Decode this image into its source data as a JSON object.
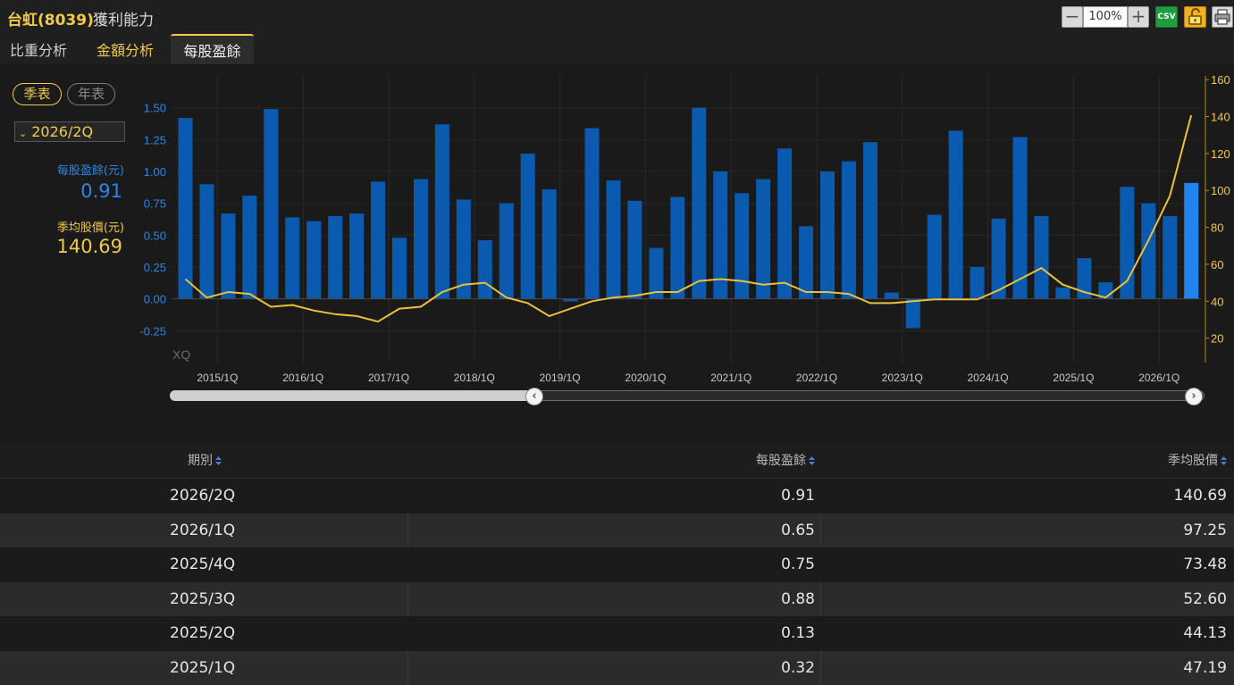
{
  "header": {
    "stock_name": "台虹(8039)",
    "page_title": "獲利能力",
    "zoom": "100%",
    "csv_label": "CSV",
    "icons": [
      "minus-icon",
      "plus-icon",
      "csv-icon",
      "unlock-icon",
      "print-icon"
    ]
  },
  "tabs": [
    {
      "label": "比重分析",
      "active": false
    },
    {
      "label": "金額分析",
      "active": false
    },
    {
      "label": "每股盈餘",
      "active": true
    }
  ],
  "side": {
    "quarter_btn": "季表",
    "year_btn": "年表",
    "period": "2026/2Q",
    "eps_label": "每股盈餘(元)",
    "eps_value": "0.91",
    "price_label": "季均股價(元)",
    "price_value": "140.69"
  },
  "colors": {
    "accent": "#f2c94c",
    "eps_bar": "#0a5ab0",
    "eps_bar_highlight": "#1f84ee",
    "eps_text": "#2d86e6",
    "price_line": "#e9c23a"
  },
  "chart_data": {
    "type": "bar",
    "watermark": "XQ",
    "x_tick_labels": [
      "2015/1Q",
      "2016/1Q",
      "2017/1Q",
      "2018/1Q",
      "2019/1Q",
      "2020/1Q",
      "2021/1Q",
      "2022/1Q",
      "2023/1Q",
      "2024/1Q",
      "2025/1Q",
      "2026/1Q"
    ],
    "y_left": {
      "ticks": [
        -0.25,
        0,
        0.25,
        0.5,
        0.75,
        1,
        1.25,
        1.5
      ],
      "tick_labels": [
        "-0.25",
        "0.00",
        "0.25",
        "0.50",
        "0.75",
        "1.00",
        "1.25",
        "1.50"
      ],
      "range": [
        -0.5,
        1.75
      ]
    },
    "y_right": {
      "ticks": [
        20,
        40,
        60,
        80,
        100,
        120,
        140,
        160
      ],
      "tick_labels": [
        "20",
        "40",
        "60",
        "80",
        "100",
        "120",
        "140",
        "160"
      ],
      "range": [
        6.8,
        162.0
      ]
    },
    "categories": [
      "2014/3Q",
      "2014/4Q",
      "2015/1Q",
      "2015/2Q",
      "2015/3Q",
      "2015/4Q",
      "2016/1Q",
      "2016/2Q",
      "2016/3Q",
      "2016/4Q",
      "2017/1Q",
      "2017/2Q",
      "2017/3Q",
      "2017/4Q",
      "2018/1Q",
      "2018/2Q",
      "2018/3Q",
      "2018/4Q",
      "2019/1Q",
      "2019/2Q",
      "2019/3Q",
      "2019/4Q",
      "2020/1Q",
      "2020/2Q",
      "2020/3Q",
      "2020/4Q",
      "2021/1Q",
      "2021/2Q",
      "2021/3Q",
      "2021/4Q",
      "2022/1Q",
      "2022/2Q",
      "2022/3Q",
      "2022/4Q",
      "2023/1Q",
      "2023/2Q",
      "2023/3Q",
      "2023/4Q",
      "2024/1Q",
      "2024/2Q",
      "2024/3Q",
      "2024/4Q",
      "2025/1Q",
      "2025/2Q",
      "2025/3Q",
      "2025/4Q",
      "2026/1Q",
      "2026/2Q"
    ],
    "series": [
      {
        "kind": "bar",
        "axis": "left",
        "values": [
          1.42,
          0.9,
          0.67,
          0.81,
          1.49,
          0.64,
          0.61,
          0.65,
          0.67,
          0.92,
          0.48,
          0.94,
          1.37,
          0.78,
          0.46,
          0.75,
          1.14,
          0.86,
          -0.02,
          1.34,
          0.93,
          0.77,
          0.4,
          0.8,
          1.5,
          1.0,
          0.83,
          0.94,
          1.18,
          0.57,
          1.0,
          1.08,
          1.23,
          0.05,
          -0.23,
          0.66,
          1.32,
          0.25,
          0.63,
          1.27,
          0.65,
          0.09,
          0.32,
          0.13,
          0.88,
          0.75,
          0.65,
          0.91
        ]
      },
      {
        "kind": "line",
        "axis": "right",
        "values": [
          52,
          42,
          45,
          44,
          37,
          38,
          35,
          33,
          32,
          29,
          36,
          37,
          45,
          49,
          50,
          42,
          39,
          32,
          36,
          40,
          42,
          43,
          45,
          45,
          51,
          52,
          51,
          49,
          50,
          45,
          45,
          44,
          39,
          39,
          40,
          41,
          41,
          41,
          46,
          52,
          58,
          49,
          45,
          42,
          51,
          73,
          97,
          140.69
        ]
      }
    ]
  },
  "table": {
    "headers": [
      "期別",
      "每股盈餘",
      "季均股價"
    ],
    "rows": [
      [
        "2026/2Q",
        "0.91",
        "140.69"
      ],
      [
        "2026/1Q",
        "0.65",
        "97.25"
      ],
      [
        "2025/4Q",
        "0.75",
        "73.48"
      ],
      [
        "2025/3Q",
        "0.88",
        "52.60"
      ],
      [
        "2025/2Q",
        "0.13",
        "44.13"
      ],
      [
        "2025/1Q",
        "0.32",
        "47.19"
      ]
    ]
  }
}
